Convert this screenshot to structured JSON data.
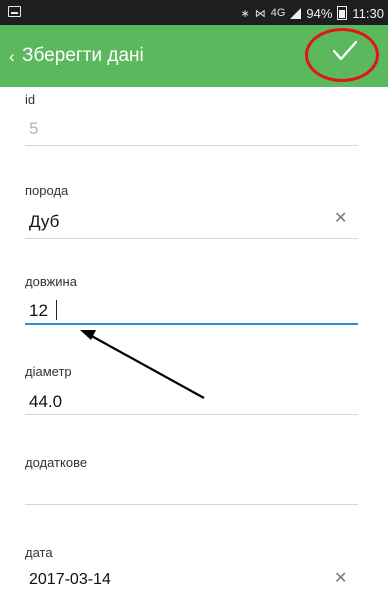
{
  "status_bar": {
    "bluetooth_icon": "bluetooth-icon",
    "mute_icon": "vibrate-icon",
    "network_label": "4G",
    "battery_percent": "94%",
    "time": "11:30"
  },
  "app_bar": {
    "title": "Зберегти дані",
    "background_color": "#5cb85c",
    "save_icon": "checkmark-icon",
    "annotation_color": "#e0141b"
  },
  "form": {
    "id": {
      "label": "id",
      "value": "5"
    },
    "breed": {
      "label": "порода",
      "value": "Дуб"
    },
    "length": {
      "label": "довжина",
      "value": "12"
    },
    "diameter": {
      "label": "діаметр",
      "value": "44.0"
    },
    "extra": {
      "label": "додаткове",
      "value": ""
    },
    "date": {
      "label": "дата",
      "value": "2017-03-14"
    }
  },
  "accent_color": "#2b8fd1"
}
